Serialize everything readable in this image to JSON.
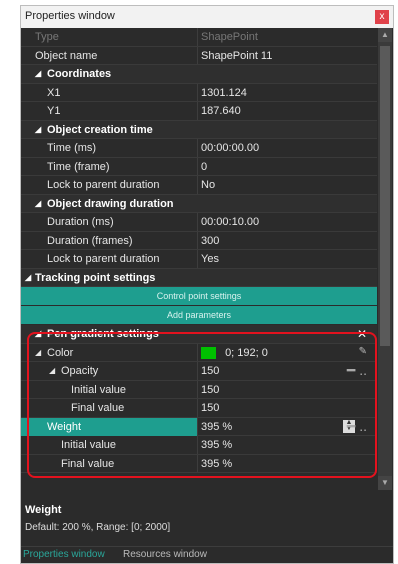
{
  "window": {
    "title": "Properties window",
    "close_label": "x"
  },
  "rows": {
    "type": {
      "name": "Type",
      "value": "ShapePoint"
    },
    "object_name": {
      "name": "Object name",
      "value": "ShapePoint 11"
    },
    "coordinates": {
      "label": "Coordinates"
    },
    "x1": {
      "name": "X1",
      "value": "1301.124"
    },
    "y1": {
      "name": "Y1",
      "value": "187.640"
    },
    "creation": {
      "label": "Object creation time"
    },
    "time_ms": {
      "name": "Time (ms)",
      "value": "00:00:00.00"
    },
    "time_frame": {
      "name": "Time (frame)",
      "value": "0"
    },
    "lock1": {
      "name": "Lock to parent duration",
      "value": "No"
    },
    "drawing": {
      "label": "Object drawing duration"
    },
    "duration_ms": {
      "name": "Duration (ms)",
      "value": "00:00:10.00"
    },
    "duration_frames": {
      "name": "Duration (frames)",
      "value": "300"
    },
    "lock2": {
      "name": "Lock to parent duration",
      "value": "Yes"
    },
    "tracking": {
      "label": "Tracking point settings"
    },
    "control_btn": "Control point settings",
    "add_params_btn": "Add parameters",
    "pen": {
      "label": "Pen gradient settings",
      "close": "✕"
    },
    "color": {
      "name": "Color",
      "value": "0; 192; 0",
      "swatch": "#00c000"
    },
    "opacity": {
      "name": "Opacity",
      "value": "150"
    },
    "op_initial": {
      "name": "Initial value",
      "value": "150"
    },
    "op_final": {
      "name": "Final value",
      "value": "150"
    },
    "weight": {
      "name": "Weight",
      "value": "395 %"
    },
    "w_initial": {
      "name": "Initial value",
      "value": "395 %"
    },
    "w_final": {
      "name": "Final value",
      "value": "395 %"
    }
  },
  "description": {
    "title": "Weight",
    "text": "Default: 200 %, Range: [0; 2000]"
  },
  "tabs": {
    "active": "Properties window",
    "inactive": "Resources window"
  },
  "colors": {
    "accent": "#1e9e8f",
    "highlight": "#e3121e",
    "background": "#2b2b2b"
  }
}
